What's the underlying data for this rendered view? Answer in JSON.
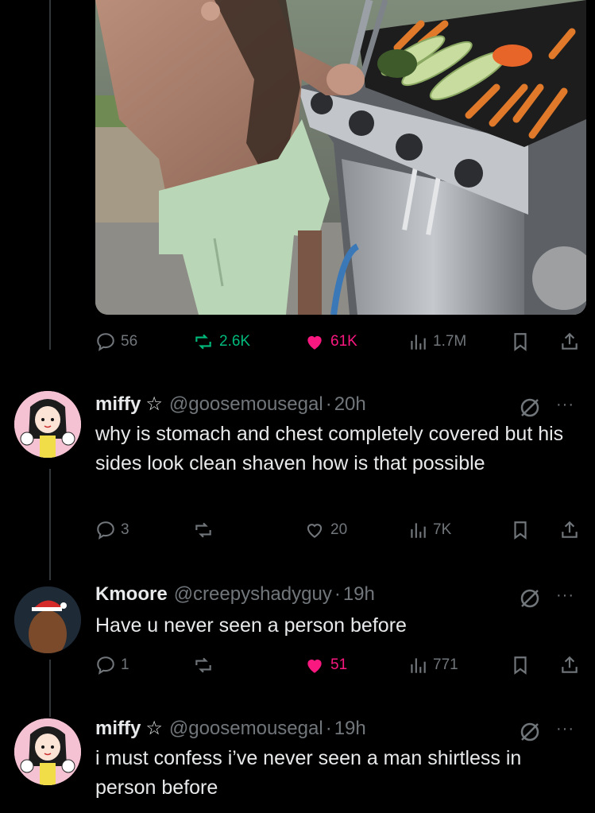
{
  "main_post": {
    "image_alt": "",
    "metrics": {
      "replies": "56",
      "reposts": "2.6K",
      "likes": "61K",
      "views": "1.7M"
    }
  },
  "replies": [
    {
      "name": "miffy",
      "badge": "☆",
      "handle": "@goosemousegal",
      "time": "20h",
      "text": "why is stomach and chest completely covered but his sides look clean shaven how is that possible",
      "metrics": {
        "replies": "3",
        "reposts": "",
        "likes": "20",
        "views": "7K"
      },
      "liked": false
    },
    {
      "name": "Kmoore",
      "badge": "",
      "handle": "@creepyshadyguy",
      "time": "19h",
      "text": "Have u never seen a person before",
      "metrics": {
        "replies": "1",
        "reposts": "",
        "likes": "51",
        "views": "771"
      },
      "liked": true
    },
    {
      "name": "miffy",
      "badge": "☆",
      "handle": "@goosemousegal",
      "time": "19h",
      "text": "i must confess i’ve never seen a man shirtless in person before"
    }
  ],
  "ui": {
    "separator": "·",
    "more_glyph": "···"
  },
  "colors": {
    "background": "#000000",
    "text": "#e7e9ea",
    "muted": "#71767b",
    "repost_active": "#00ba7c",
    "like_active": "#f91880",
    "line": "#333639"
  },
  "icons": [
    "reply-icon",
    "repost-icon",
    "like-icon",
    "views-icon",
    "bookmark-icon",
    "share-icon",
    "grok-icon",
    "more-icon"
  ]
}
